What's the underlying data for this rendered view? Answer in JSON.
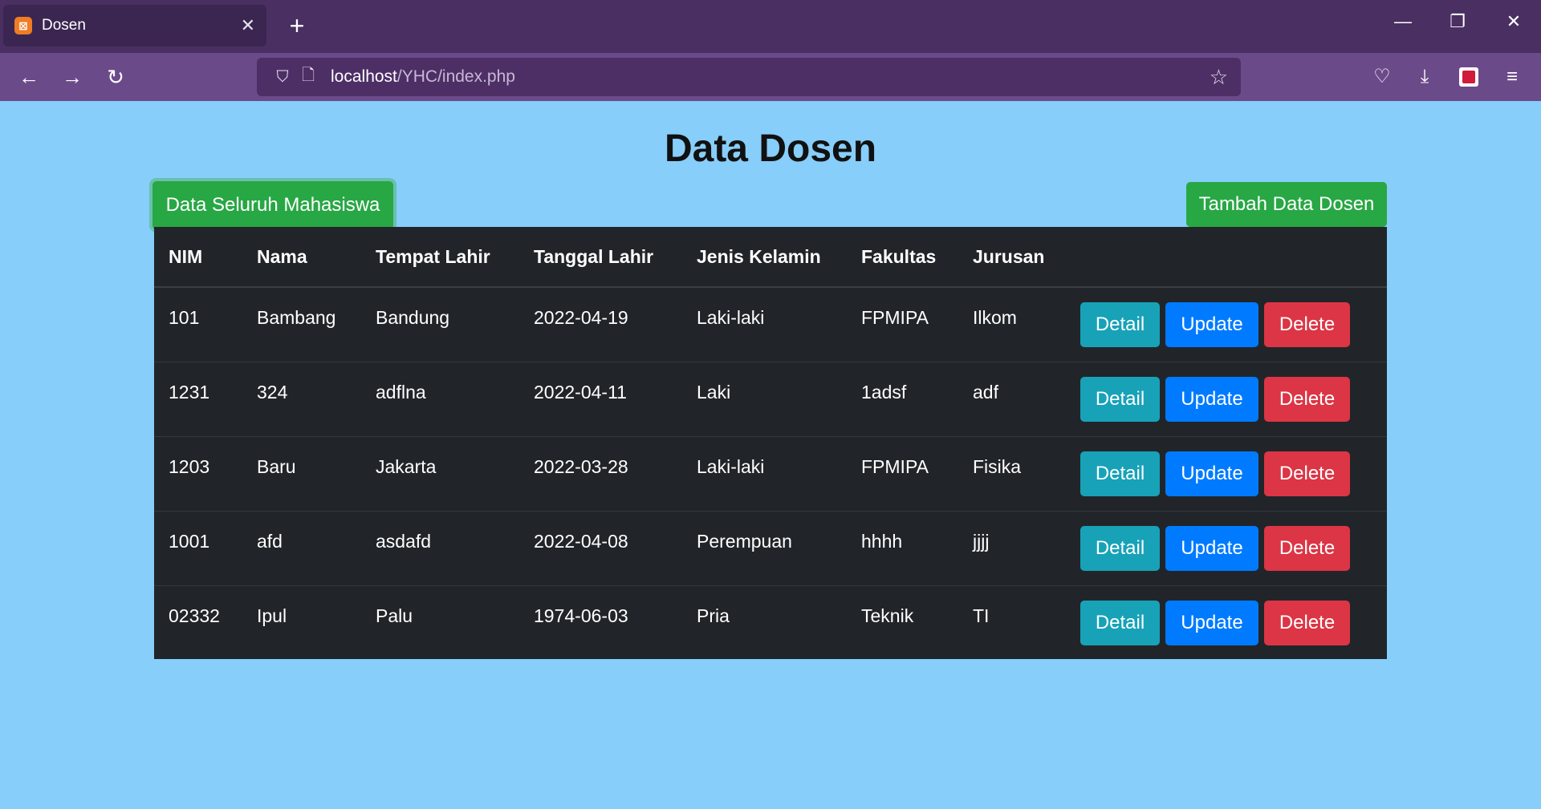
{
  "browser": {
    "tab_title": "Dosen",
    "tab_close": "✕",
    "new_tab": "+",
    "url_host": "localhost",
    "url_path": "/YHC/index.php"
  },
  "page": {
    "title": "Data Dosen",
    "btn_mahasiswa": "Data Seluruh Mahasiswa",
    "btn_tambah": "Tambah Data Dosen"
  },
  "table": {
    "headers": [
      "NIM",
      "Nama",
      "Tempat Lahir",
      "Tanggal Lahir",
      "Jenis Kelamin",
      "Fakultas",
      "Jurusan",
      ""
    ],
    "rows": [
      [
        "101",
        "Bambang",
        "Bandung",
        "2022-04-19",
        "Laki-laki",
        "FPMIPA",
        "Ilkom"
      ],
      [
        "1231",
        "324",
        "adflna",
        "2022-04-11",
        "Laki",
        "1adsf",
        "adf"
      ],
      [
        "1203",
        "Baru",
        "Jakarta",
        "2022-03-28",
        "Laki-laki",
        "FPMIPA",
        "Fisika"
      ],
      [
        "1001",
        "afd",
        "asdafd",
        "2022-04-08",
        "Perempuan",
        "hhhh",
        "jjjj"
      ],
      [
        "02332",
        "Ipul",
        "Palu",
        "1974-06-03",
        "Pria",
        "Teknik",
        "TI"
      ]
    ],
    "actions": {
      "detail": "Detail",
      "update": "Update",
      "delete": "Delete"
    }
  },
  "colors": {
    "background": "#87cefa",
    "table_bg": "#212529",
    "green": "#28a745",
    "detail": "#17a2b8",
    "update": "#007bff",
    "delete": "#dc3545"
  }
}
